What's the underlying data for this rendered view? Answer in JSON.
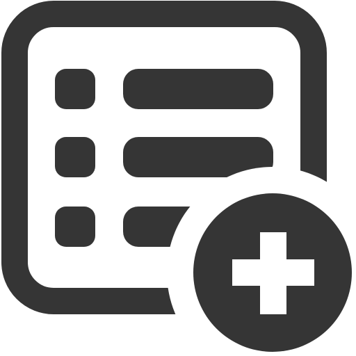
{
  "icon": {
    "name": "add-list-item-icon",
    "components": [
      "list-frame",
      "list-bullets",
      "list-lines",
      "add-badge",
      "plus-sign"
    ]
  },
  "colors": {
    "foreground": "#353535",
    "background": "#ffffff"
  }
}
